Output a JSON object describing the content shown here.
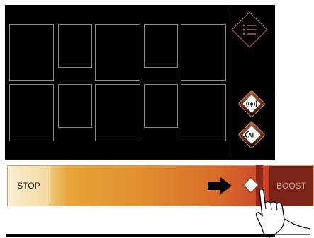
{
  "colors": {
    "panel_bg": "#000000",
    "accent": "#c2714e",
    "cavity_border": "#8a8a8a",
    "slider_start": "#f6e3b8",
    "slider_end": "#b2281f",
    "boost_bg": "#7a2316"
  },
  "hob": {
    "zones": 10,
    "buttons": {
      "menu_icon": "menu-list-icon",
      "wifi_icon": "wireless-signal-icon",
      "ai_icon": "ai-badge-icon",
      "ai_label": "AI"
    }
  },
  "slider": {
    "stop_label": "STOP",
    "boost_label": "BOOST",
    "level": 0.86,
    "direction_icon": "arrow-right-icon",
    "pointer_icon": "hand-pointer-icon"
  }
}
